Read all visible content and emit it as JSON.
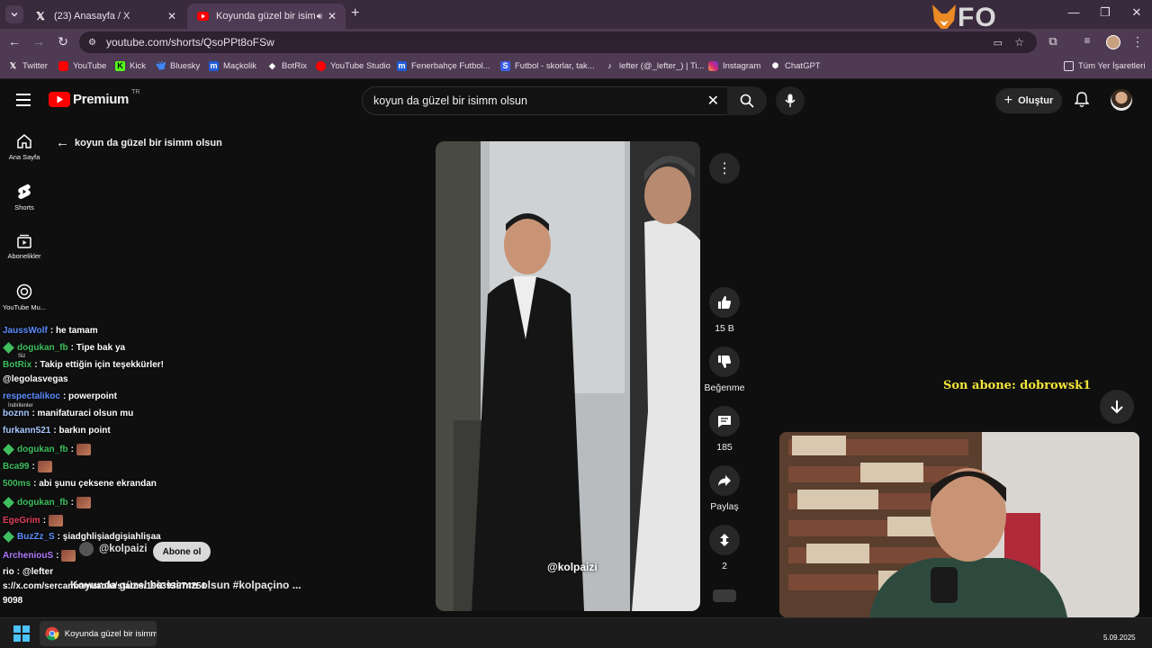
{
  "browser": {
    "tabs": [
      {
        "title": "(23) Anasayfa / X",
        "icon": "x-logo-icon"
      },
      {
        "title": "Koyunda güzel bir isimm ol",
        "icon": "youtube-icon"
      }
    ],
    "new_tab": "+",
    "url": "youtube.com/shorts/QsoPPt8oFSw",
    "bookmarks": [
      "Twitter",
      "YouTube",
      "Kick",
      "Bluesky",
      "Maçkolik",
      "BotRix",
      "YouTube Studio",
      "Fenerbahçe Futbol...",
      "Futbol - skorlar, tak...",
      "lefter (@_lefter_) | Ti...",
      "Instagram",
      "ChatGPT"
    ],
    "all_bookmarks": "Tüm Yer İşaretleri",
    "overlay_logo": "FO"
  },
  "youtube": {
    "logo": "Premium",
    "country": "TR",
    "search_query": "koyun da güzel bir isimm olsun",
    "create_label": "Oluştur",
    "nav": [
      "Ana Sayfa",
      "Shorts",
      "Abonelikler",
      "YouTube Mu..."
    ],
    "nav_extra": [
      "Siz",
      "İndirilenler"
    ],
    "back_title": "koyun da güzel bir isimm olsun",
    "channel": "@kolpaizi",
    "subscribe_label": "Abone ol",
    "video_title": "Koyunda güzel bir isimm olsun #kolpaçino ...",
    "watermark": "@kolpaizi",
    "actions": {
      "likes": "15 B",
      "dislike_label": "Beğenme",
      "comments": "185",
      "share_label": "Paylaş",
      "remix_count": "2"
    }
  },
  "chat": [
    {
      "user": "JaussWolf",
      "color": "#5b8cff",
      "text": ": he tamam",
      "badge": false,
      "emote": false
    },
    {
      "user": "dogukan_fb",
      "color": "#3fbf5f",
      "text": ": Tipe bak ya",
      "badge": true,
      "emote": false
    },
    {
      "user": "BotRix",
      "color": "#3fbf5f",
      "text": ": Takip ettiğin için teşekkürler!",
      "badge": false,
      "emote": false
    },
    {
      "user": "",
      "color": "#ffffff",
      "text": "@legolasvegas",
      "badge": false,
      "emote": false
    },
    {
      "user": "respectalikoc",
      "color": "#5b8cff",
      "text": ": powerpoint",
      "badge": false,
      "emote": false
    },
    {
      "user": "boznn",
      "color": "#a8c8ff",
      "text": ": manifaturaci olsun mu",
      "badge": false,
      "emote": false
    },
    {
      "user": "furkann521",
      "color": "#a8c8ff",
      "text": ": barkın point",
      "badge": false,
      "emote": false
    },
    {
      "user": "dogukan_fb",
      "color": "#3fbf5f",
      "text": ":",
      "badge": true,
      "emote": true
    },
    {
      "user": "Bca99",
      "color": "#3fbf5f",
      "text": ":",
      "badge": false,
      "emote": true
    },
    {
      "user": "500ms",
      "color": "#3fbf5f",
      "text": ": abi şunu çeksene ekrandan",
      "badge": false,
      "emote": false
    },
    {
      "user": "dogukan_fb",
      "color": "#3fbf5f",
      "text": ":",
      "badge": true,
      "emote": true
    },
    {
      "user": "EgeGrim",
      "color": "#e0405a",
      "text": ":",
      "badge": false,
      "emote": true
    },
    {
      "user": "BuzZz_S",
      "color": "#5b8cff",
      "text": ": şiadghlişiadgişiahlişaa",
      "badge": true,
      "emote": false
    },
    {
      "user": "ArcheniouS",
      "color": "#b07cff",
      "text": ":",
      "badge": false,
      "emote": true
    },
    {
      "user": "rio",
      "color": "#ffffff",
      "text": ": @lefter",
      "badge": false,
      "emote": false
    },
    {
      "user": "",
      "color": "#ffffff",
      "text": "s://x.com/sercanhamzaolu/status/196393974251",
      "badge": false,
      "emote": false
    },
    {
      "user": "",
      "color": "#ffffff",
      "text": "9098",
      "badge": false,
      "emote": false
    }
  ],
  "stream_overlay": {
    "last_sub": "Son abone: dobrowsk1"
  },
  "taskbar": {
    "app_title": "Koyunda güzel bir isimm",
    "date": "5.09.2025"
  }
}
